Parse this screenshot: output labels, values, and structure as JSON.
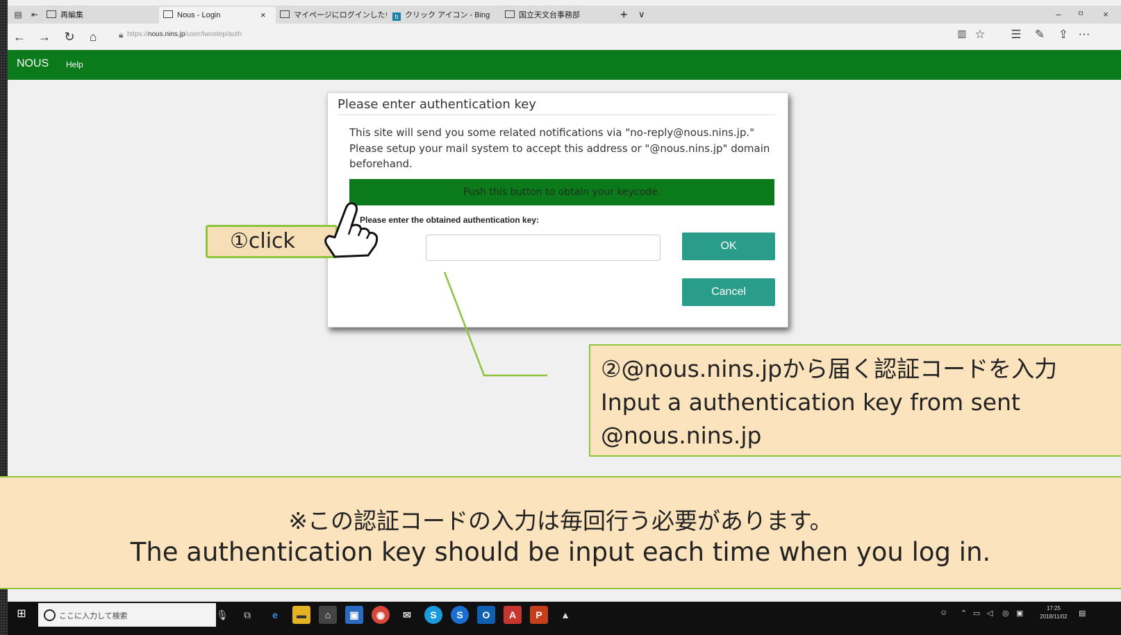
{
  "browser": {
    "tabs": [
      {
        "label": "再編集"
      },
      {
        "label": "Nous - Login",
        "close": "×"
      },
      {
        "label": "マイページにログインしたい場合"
      },
      {
        "label": "クリック アイコン - Bing",
        "badge": "b"
      },
      {
        "label": "国立天文台事務部"
      }
    ],
    "new_tab": "+",
    "tab_menu": "∨",
    "window_controls": {
      "minimize": "–",
      "maximize": "ㅁ",
      "close": "×"
    },
    "url": {
      "prefix": "https://",
      "host": "nous.nins.jp",
      "path": "/user/twostep/auth"
    }
  },
  "site": {
    "brand": "NOUS",
    "help": "Help",
    "header_color": "#0a7a1a"
  },
  "dialog": {
    "title": "Please enter authentication key",
    "description": "This site will send you some related notifications via \"no-reply@nous.nins.jp.\" Please setup your mail system to accept this address or \"@nous.nins.jp\" domain beforehand.",
    "obtain_button": "Push this button to obtain your keycode.",
    "key_label": "Please enter the obtained authentication key:",
    "key_value": "",
    "ok_button": "OK",
    "cancel_button": "Cancel",
    "button_color": "#2a9d8a"
  },
  "annotations": {
    "click": "①click",
    "note_line1": "②@nous.nins.jpから届く認証コードを入力",
    "note_line2": "Input a authentication key from sent",
    "note_line3": "@nous.nins.jp",
    "border_color": "#8cc43e",
    "fill_color": "#fbe3bd"
  },
  "banner": {
    "jp": "※この認証コードの入力は毎回行う必要があります。",
    "en": "The authentication key should be input each time when you log in."
  },
  "taskbar": {
    "search_placeholder": "ここに入力して検索",
    "time": "17:25",
    "date": "2018/11/02"
  }
}
